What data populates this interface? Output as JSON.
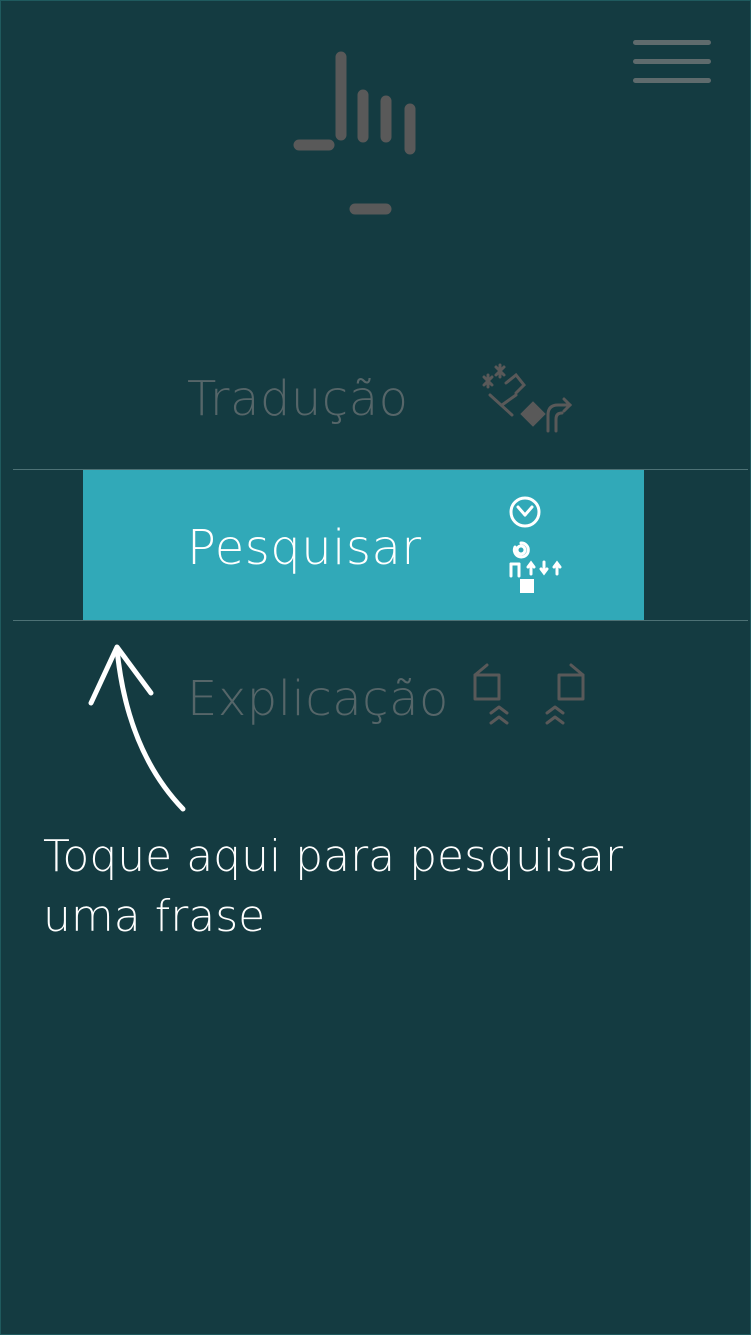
{
  "header": {
    "menu_icon": "hamburger-menu-icon",
    "logo_icon": "hand-sign-logo-icon"
  },
  "menu": {
    "items": [
      {
        "label": "Tradução",
        "icon": "translate-sign-icon",
        "selected": false
      },
      {
        "label": "Pesquisar",
        "icon": "search-sign-icon",
        "selected": true
      },
      {
        "label": "Explicação",
        "icon": "explain-sign-icon",
        "selected": false
      }
    ]
  },
  "hint": {
    "text": "Toque aqui para pesquisar uma frase",
    "arrow_icon": "curved-arrow-up-icon"
  },
  "colors": {
    "background": "#143b41",
    "accent": "#31a9b8",
    "inactive_text": "#566669",
    "icon_gray": "#595959",
    "white": "#ffffff"
  }
}
